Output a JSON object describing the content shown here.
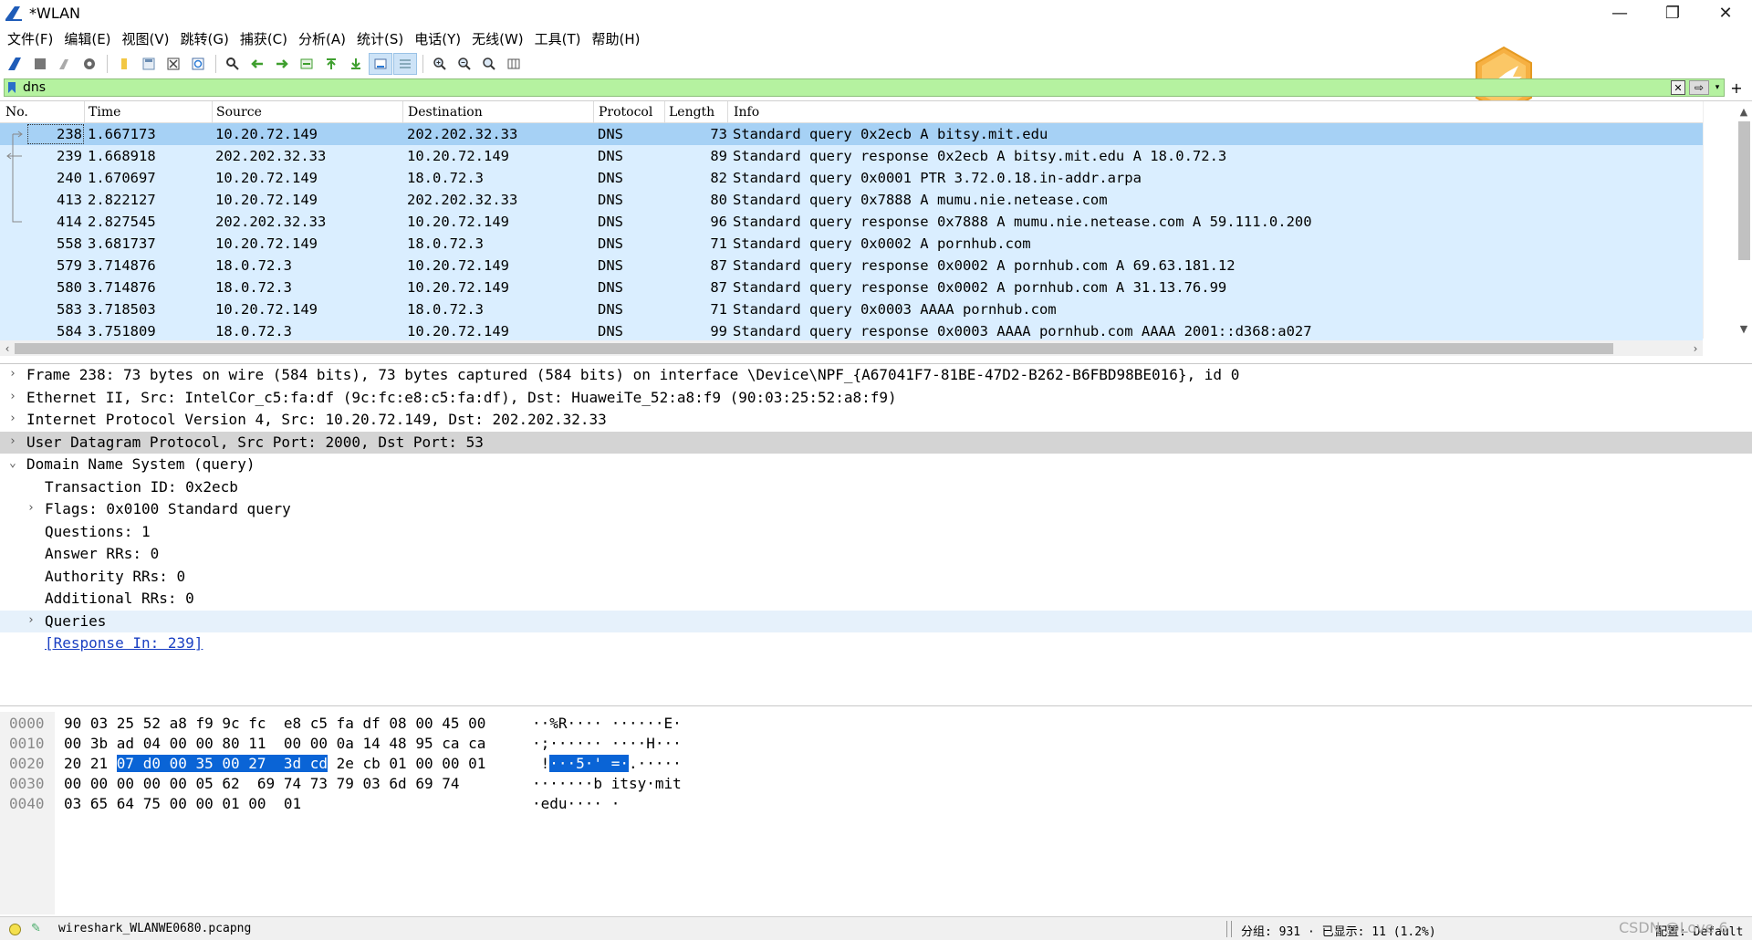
{
  "window": {
    "title": "*WLAN",
    "controls": [
      "—",
      "❐",
      "✕"
    ]
  },
  "menu": [
    "文件(F)",
    "编辑(E)",
    "视图(V)",
    "跳转(G)",
    "捕获(C)",
    "分析(A)",
    "统计(S)",
    "电话(Y)",
    "无线(W)",
    "工具(T)",
    "帮助(H)"
  ],
  "filter": {
    "value": "dns"
  },
  "packet_list": {
    "columns": [
      "No.",
      "Time",
      "Source",
      "Destination",
      "Protocol",
      "Length",
      "Info"
    ],
    "rows": [
      {
        "no": "238",
        "time": "1.667173",
        "src": "10.20.72.149",
        "dst": "202.202.32.33",
        "proto": "DNS",
        "len": "73",
        "info": "Standard query 0x2ecb A bitsy.mit.edu",
        "selected": true
      },
      {
        "no": "239",
        "time": "1.668918",
        "src": "202.202.32.33",
        "dst": "10.20.72.149",
        "proto": "DNS",
        "len": "89",
        "info": "Standard query response 0x2ecb A bitsy.mit.edu A 18.0.72.3"
      },
      {
        "no": "240",
        "time": "1.670697",
        "src": "10.20.72.149",
        "dst": "18.0.72.3",
        "proto": "DNS",
        "len": "82",
        "info": "Standard query 0x0001 PTR 3.72.0.18.in-addr.arpa"
      },
      {
        "no": "413",
        "time": "2.822127",
        "src": "10.20.72.149",
        "dst": "202.202.32.33",
        "proto": "DNS",
        "len": "80",
        "info": "Standard query 0x7888 A mumu.nie.netease.com"
      },
      {
        "no": "414",
        "time": "2.827545",
        "src": "202.202.32.33",
        "dst": "10.20.72.149",
        "proto": "DNS",
        "len": "96",
        "info": "Standard query response 0x7888 A mumu.nie.netease.com A 59.111.0.200"
      },
      {
        "no": "558",
        "time": "3.681737",
        "src": "10.20.72.149",
        "dst": "18.0.72.3",
        "proto": "DNS",
        "len": "71",
        "info": "Standard query 0x0002 A pornhub.com"
      },
      {
        "no": "579",
        "time": "3.714876",
        "src": "18.0.72.3",
        "dst": "10.20.72.149",
        "proto": "DNS",
        "len": "87",
        "info": "Standard query response 0x0002 A pornhub.com A 69.63.181.12"
      },
      {
        "no": "580",
        "time": "3.714876",
        "src": "18.0.72.3",
        "dst": "10.20.72.149",
        "proto": "DNS",
        "len": "87",
        "info": "Standard query response 0x0002 A pornhub.com A 31.13.76.99"
      },
      {
        "no": "583",
        "time": "3.718503",
        "src": "10.20.72.149",
        "dst": "18.0.72.3",
        "proto": "DNS",
        "len": "71",
        "info": "Standard query 0x0003 AAAA pornhub.com"
      },
      {
        "no": "584",
        "time": "3.751809",
        "src": "18.0.72.3",
        "dst": "10.20.72.149",
        "proto": "DNS",
        "len": "99",
        "info": "Standard query response 0x0003 AAAA pornhub.com AAAA 2001::d368:a027"
      }
    ]
  },
  "details": [
    {
      "text": "Frame 238: 73 bytes on wire (584 bits), 73 bytes captured (584 bits) on interface \\Device\\NPF_{A67041F7-81BE-47D2-B262-B6FBD98BE016}, id 0",
      "arrow": "›",
      "indent": 0
    },
    {
      "text": "Ethernet II, Src: IntelCor_c5:fa:df (9c:fc:e8:c5:fa:df), Dst: HuaweiTe_52:a8:f9 (90:03:25:52:a8:f9)",
      "arrow": "›",
      "indent": 0
    },
    {
      "text": "Internet Protocol Version 4, Src: 10.20.72.149, Dst: 202.202.32.33",
      "arrow": "›",
      "indent": 0
    },
    {
      "text": "User Datagram Protocol, Src Port: 2000, Dst Port: 53",
      "arrow": "›",
      "indent": 0,
      "highlight": "hl"
    },
    {
      "text": "Domain Name System (query)",
      "arrow": "⌄",
      "indent": 0
    },
    {
      "text": "Transaction ID: 0x2ecb",
      "arrow": "",
      "indent": 1
    },
    {
      "text": "Flags: 0x0100 Standard query",
      "arrow": "›",
      "indent": 1
    },
    {
      "text": "Questions: 1",
      "arrow": "",
      "indent": 1
    },
    {
      "text": "Answer RRs: 0",
      "arrow": "",
      "indent": 1
    },
    {
      "text": "Authority RRs: 0",
      "arrow": "",
      "indent": 1
    },
    {
      "text": "Additional RRs: 0",
      "arrow": "",
      "indent": 1
    },
    {
      "text": "Queries",
      "arrow": "›",
      "indent": 1,
      "highlight": "hl2"
    },
    {
      "text": "[Response In: 239]",
      "arrow": "",
      "indent": 1,
      "link": true
    }
  ],
  "bytes": [
    {
      "off": "0000",
      "pre": "90 03 25 52 a8 f9 9c fc  e8 c5 fa df 08 00 45 00",
      "sel": "",
      "post": "",
      "apre": "··%R···· ······E·",
      "asel": "",
      "apost": ""
    },
    {
      "off": "0010",
      "pre": "00 3b ad 04 00 00 80 11  00 00 0a 14 48 95 ca ca",
      "sel": "",
      "post": "",
      "apre": "·;······ ····H···",
      "asel": "",
      "apost": ""
    },
    {
      "off": "0020",
      "pre": "20 21 ",
      "sel": "07 d0 00 35 00 27  3d cd",
      "post": " 2e cb 01 00 00 01",
      "apre": " !",
      "asel": "···5·' =·",
      "apost": ".·····"
    },
    {
      "off": "0030",
      "pre": "00 00 00 00 00 05 62  69 74 73 79 03 6d 69 74",
      "sel": "",
      "post": "",
      "apre": "·······b itsy·mit",
      "asel": "",
      "apost": ""
    },
    {
      "off": "0040",
      "pre": "03 65 64 75 00 00 01 00  01",
      "sel": "",
      "post": "",
      "apre": "·edu···· ·",
      "asel": "",
      "apost": ""
    }
  ],
  "status": {
    "file": "wireshark_WLANWE0680.pcapng",
    "packets": "分组: 931 · 已显示: 11 (1.2%)",
    "profile": "配置: Default",
    "watermark": "CSDN @Love 6"
  }
}
